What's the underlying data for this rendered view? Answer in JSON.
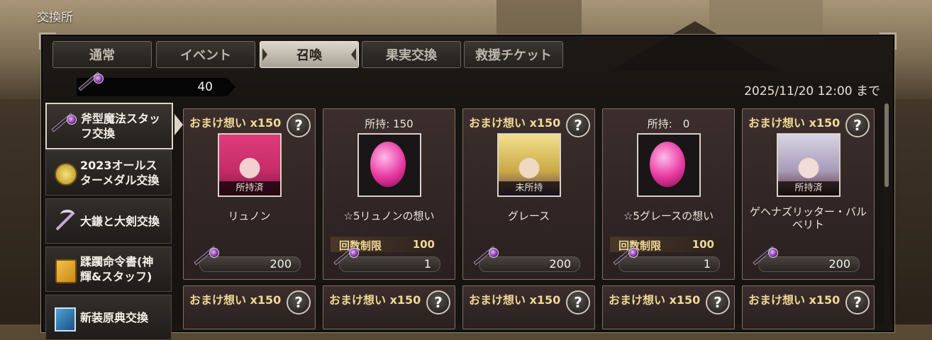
{
  "window": {
    "title": "交換所"
  },
  "tabs": [
    {
      "label": "通常",
      "active": false
    },
    {
      "label": "イベント",
      "active": false
    },
    {
      "label": "召喚",
      "active": true
    },
    {
      "label": "果実交換",
      "active": false
    },
    {
      "label": "救援チケット",
      "active": false
    }
  ],
  "currency": {
    "icon": "staff-icon",
    "value": "40"
  },
  "deadline": "2025/11/20 12:00 まで",
  "sidebar": {
    "items": [
      {
        "label1": "斧型魔法スタッ",
        "label2": "フ交換",
        "icon": "staff-icon",
        "active": true
      },
      {
        "label1": "2023オールス",
        "label2": "ターメダル交換",
        "icon": "medal-icon",
        "active": false
      },
      {
        "label1": "大鎌と大剣交換",
        "label2": "",
        "icon": "scythe-icon",
        "active": false
      },
      {
        "label1": "蹂躙命令書(神",
        "label2": "輝&スタッフ)",
        "icon": "scroll-icon",
        "active": false
      },
      {
        "label1": "新装原典交換",
        "label2": "",
        "icon": "book-icon",
        "active": false
      }
    ]
  },
  "cards_row1": [
    {
      "bonus": "おまけ想い x150",
      "owned": "",
      "status": "所持済",
      "name": "リュノン",
      "limit_label": "",
      "limit": "",
      "cost": "200",
      "kind": "character-pink"
    },
    {
      "bonus": "",
      "owned": "所持: 150",
      "status": "",
      "name": "☆5リュノンの想い",
      "limit_label": "回数制限",
      "limit": "100",
      "cost": "1",
      "kind": "gem-pink"
    },
    {
      "bonus": "おまけ想い x150",
      "owned": "",
      "status": "未所持",
      "name": "グレース",
      "limit_label": "",
      "limit": "",
      "cost": "200",
      "kind": "character-blonde"
    },
    {
      "bonus": "",
      "owned": "所持:　0",
      "status": "",
      "name": "☆5グレースの想い",
      "limit_label": "回数制限",
      "limit": "100",
      "cost": "1",
      "kind": "gem-blonde"
    },
    {
      "bonus": "おまけ想い x150",
      "owned": "",
      "status": "所持済",
      "name": "ゲヘナズリッター・バルベリト",
      "limit_label": "",
      "limit": "",
      "cost": "200",
      "kind": "character-silver"
    }
  ],
  "cards_row2": [
    {
      "bonus": "おまけ想い x150"
    },
    {
      "bonus": "おまけ想い x150"
    },
    {
      "bonus": "おまけ想い x150"
    },
    {
      "bonus": "おまけ想い x150"
    },
    {
      "bonus": "おまけ想い x150"
    }
  ],
  "help_label": "?",
  "colors": {
    "accent_gold": "#f0d896",
    "panel_bg": "#161210",
    "active_tab": "#dcd6cb"
  }
}
